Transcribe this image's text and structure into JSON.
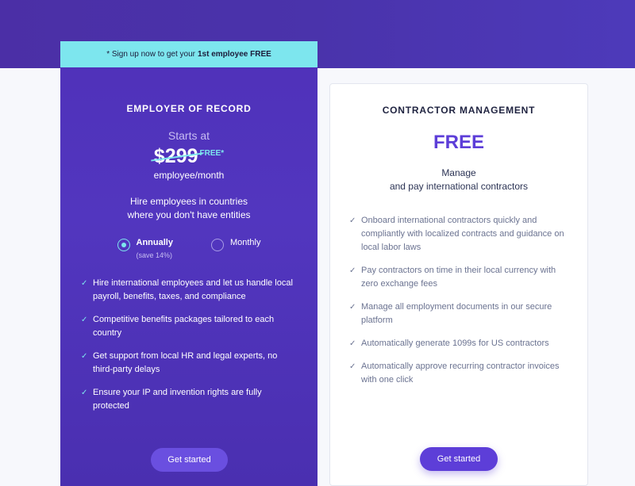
{
  "eor": {
    "banner_prefix": "* Sign up now to get your",
    "banner_bold": "1st employee FREE",
    "title": "EMPLOYER OF RECORD",
    "starts_at": "Starts at",
    "price_old": "$299",
    "price_free": "FREE*",
    "per": "employee/month",
    "desc_line1": "Hire employees in countries",
    "desc_line2": "where you don't have entities",
    "billing": {
      "annually": "Annually",
      "annually_sub": "(save 14%)",
      "monthly": "Monthly",
      "selected": "annually"
    },
    "features": [
      "Hire international employees and let us handle local payroll, benefits, taxes, and compliance",
      "Competitive benefits packages tailored to each country",
      "Get support from local HR and legal experts, no third-party delays",
      "Ensure your IP and invention rights are fully protected"
    ],
    "cta": "Get started"
  },
  "cm": {
    "title": "CONTRACTOR MANAGEMENT",
    "price": "FREE",
    "desc_line1": "Manage",
    "desc_line2": "and pay international contractors",
    "features": [
      "Onboard international contractors quickly and compliantly with localized contracts and guidance on local labor laws",
      "Pay contractors on time in their local currency with zero exchange fees",
      "Manage all employment documents in our secure platform",
      "Automatically generate 1099s for US contractors",
      "Automatically approve recurring contractor invoices with one click"
    ],
    "cta": "Get started"
  },
  "icons": {
    "check": "check-icon",
    "radio": "radio-icon"
  },
  "colors": {
    "accent_purple": "#5d3ed8",
    "eor_card": "#4f31b9",
    "banner_cyan": "#7de6ee"
  }
}
